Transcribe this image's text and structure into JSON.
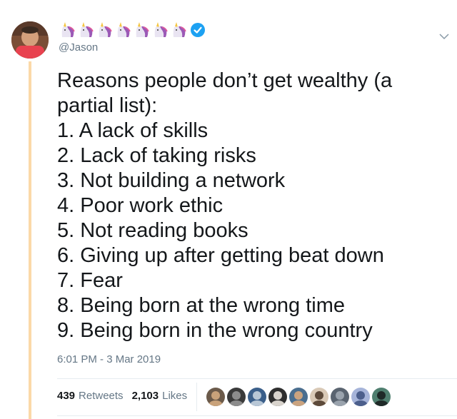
{
  "author": {
    "handle": "@Jason",
    "name_emoji": [
      "unicorn-icon",
      "unicorn-icon",
      "unicorn-icon",
      "unicorn-icon",
      "unicorn-icon",
      "unicorn-icon",
      "unicorn-icon"
    ],
    "verified": true
  },
  "tweet": {
    "lines": [
      "Reasons people don’t get wealthy (a",
      "partial list):",
      "1. A lack of skills",
      "2. Lack of taking risks",
      "3. Not building a network",
      "4. Poor work ethic",
      "5. Not reading books",
      "6. Giving up after getting beat down",
      "7. Fear",
      "8. Being born at the wrong time",
      "9. Being born in the wrong country"
    ],
    "timestamp": "6:01 PM - 3 Mar 2019"
  },
  "stats": {
    "retweets_count": "439",
    "retweets_label": "Retweets",
    "likes_count": "2,103",
    "likes_label": "Likes"
  },
  "liker_avatars": [
    {
      "colors": [
        "#6b5a4a",
        "#c9a27a"
      ]
    },
    {
      "colors": [
        "#3a3a3a",
        "#8c8c8c"
      ]
    },
    {
      "colors": [
        "#3b5f8a",
        "#b8c7d6"
      ]
    },
    {
      "colors": [
        "#2e2e2e",
        "#d8d3cc"
      ]
    },
    {
      "colors": [
        "#4a6e8f",
        "#caa37f"
      ]
    },
    {
      "colors": [
        "#d9c9b6",
        "#5d4a3a"
      ]
    },
    {
      "colors": [
        "#5a6470",
        "#9aa3ad"
      ]
    },
    {
      "colors": [
        "#a6b4d9",
        "#4c5f8c"
      ]
    },
    {
      "colors": [
        "#4f7f6f",
        "#1f2a28"
      ]
    }
  ],
  "colors": {
    "thread_line": "#fbd9a8",
    "secondary_text": "#657786",
    "verified_blue": "#1da1f2",
    "unicorn_mane": "#9b59b6"
  }
}
